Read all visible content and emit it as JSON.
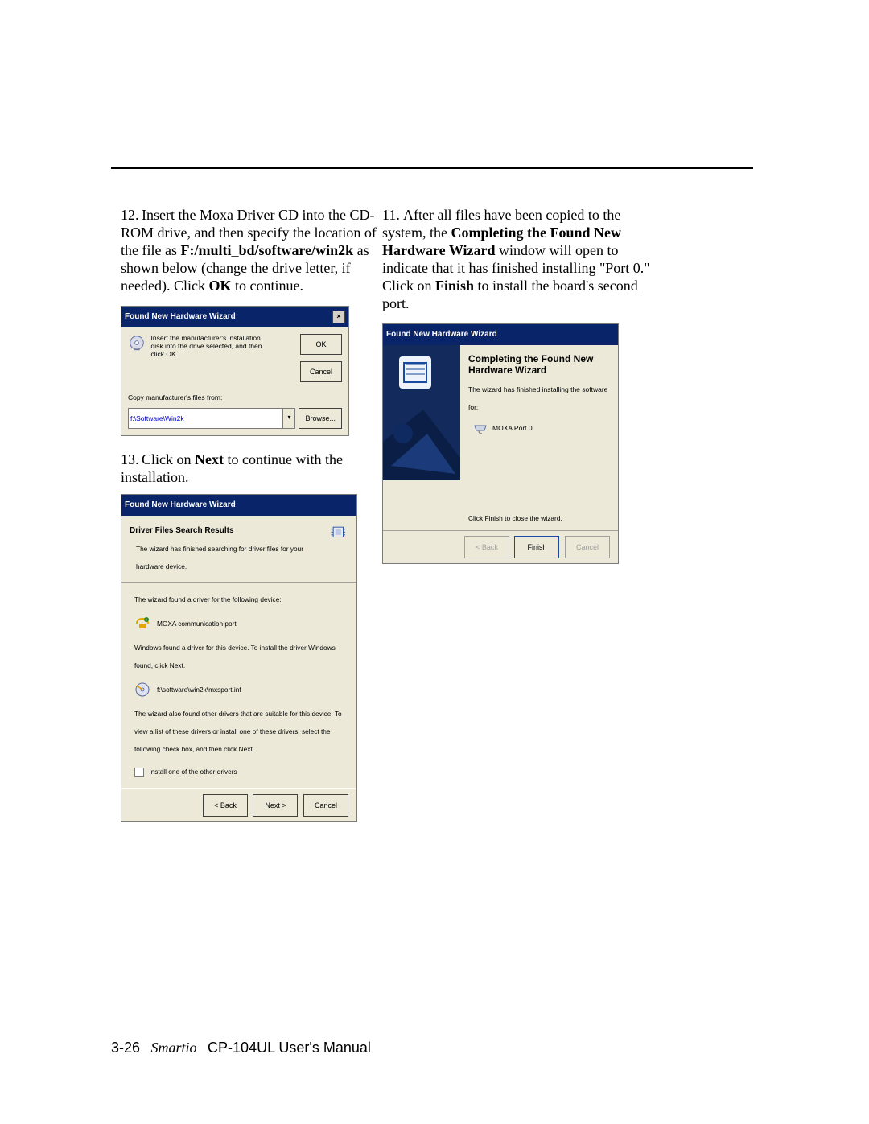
{
  "footer": {
    "page_num": "3-26",
    "book": "Smartio",
    "manual": "CP-104UL User's Manual"
  },
  "left": {
    "step12": {
      "num": "12.",
      "t1": "Insert the Moxa Driver CD into the CD-ROM drive, and then specify the location of the file as ",
      "path": "F:/multi_bd/software/win2k",
      "t2": " as shown below (change the drive letter, if needed). Click ",
      "ok": "OK",
      "t3": " to continue."
    },
    "dlg1": {
      "title": "Found New Hardware Wizard",
      "msg": "Insert the manufacturer's installation disk into the drive selected, and then click OK.",
      "ok": "OK",
      "cancel": "Cancel",
      "copy": "Copy manufacturer's files from:",
      "path": "f:\\Software\\Win2k",
      "browse": "Browse..."
    },
    "step13": {
      "num": "13.",
      "t1": "Click on ",
      "next": "Next",
      "t2": " to continue with the installation."
    },
    "dlg2": {
      "title": "Found New Hardware Wizard",
      "head_t": "Driver Files Search Results",
      "head_s": "The wizard has finished searching for driver files for your hardware device.",
      "body1": "The wizard found a driver for the following device:",
      "device": "MOXA communication port",
      "body2": "Windows found a driver for this device. To install the driver Windows found, click Next.",
      "inf": "f:\\software\\win2k\\mxsport.inf",
      "body3": "The wizard also found other drivers that are suitable for this device. To view a list of these drivers or install one of these drivers, select the following check box, and then click Next.",
      "chk": "Install one of the other drivers",
      "back": "< Back",
      "next": "Next >",
      "cancel": "Cancel"
    }
  },
  "right": {
    "step11": {
      "num": "11.",
      "t1": "After all files have been copied to the system, the ",
      "bold1": "Completing the Found New Hardware Wizard",
      "t2": " window will open to indicate that it has finished installing \"Port 0.\" Click on ",
      "bold2": "Finish",
      "t3": " to install the board's second port."
    },
    "dlg3": {
      "title": "Found New Hardware Wizard",
      "main_t": "Completing the Found New Hardware Wizard",
      "sub": "The wizard has finished installing the software for:",
      "port": "MOXA Port 0",
      "close": "Click Finish to close the wizard.",
      "back": "< Back",
      "finish": "Finish",
      "cancel": "Cancel"
    }
  }
}
